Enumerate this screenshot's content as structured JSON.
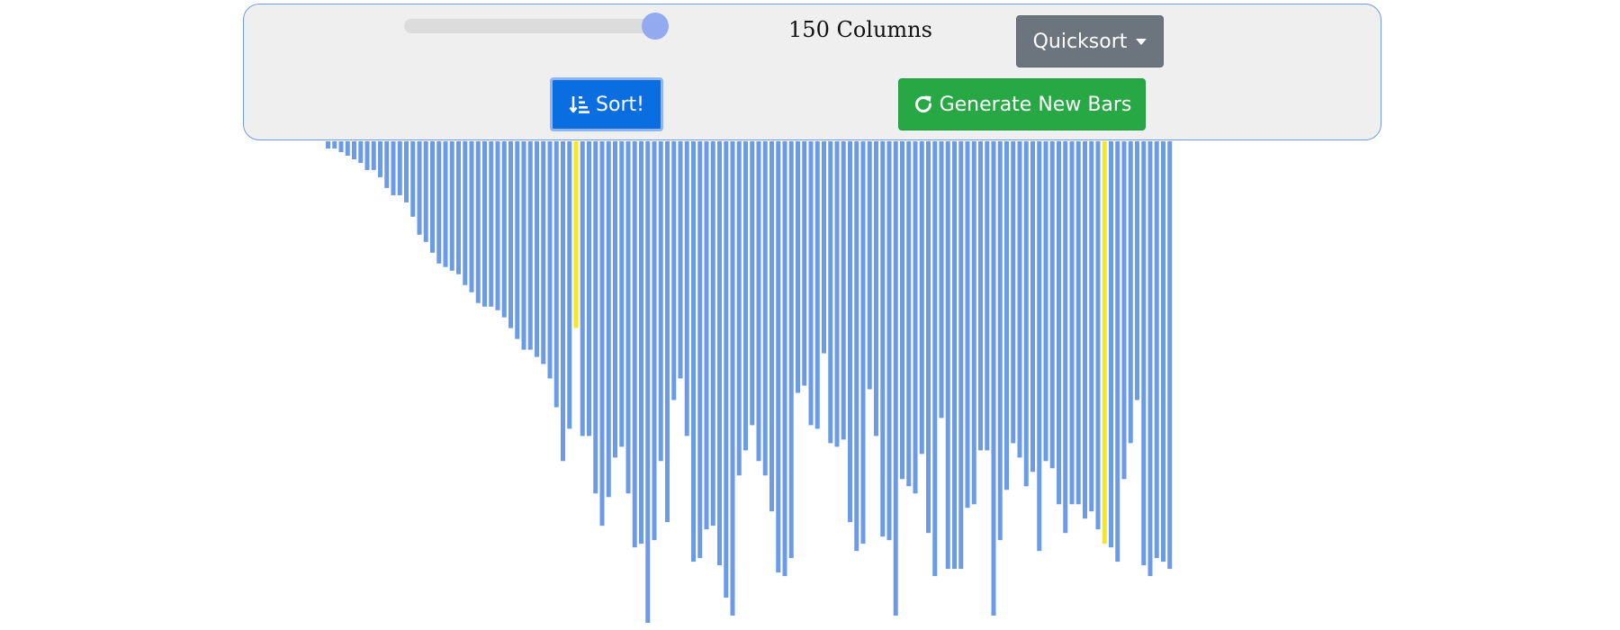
{
  "controls": {
    "column_count_label": "150 Columns",
    "slider_value": 150,
    "algorithm_label": "Quicksort",
    "sort_label": "Sort!",
    "generate_label": "Generate New Bars"
  },
  "icons": {
    "sort": "sort-descending-icon",
    "generate": "refresh-icon",
    "dropdown": "caret-down-icon"
  },
  "colors": {
    "bar": "#6b9be6",
    "highlight": "#f5e81c",
    "sort_button": "#0a6de0",
    "generate_button": "#28a745",
    "algorithm_button": "#6c757d"
  },
  "chart_data": {
    "type": "bar",
    "bar_count": 130,
    "values": [
      2,
      2,
      3,
      4,
      5,
      6,
      8,
      8,
      10,
      13,
      15,
      15,
      17,
      21,
      26,
      28,
      31,
      34,
      35,
      36,
      37,
      40,
      42,
      45,
      46,
      46,
      47,
      49,
      52,
      55,
      58,
      58,
      60,
      62,
      66,
      74,
      89,
      80,
      52,
      82,
      82,
      98,
      107,
      99,
      88,
      85,
      98,
      113,
      112,
      134,
      111,
      89,
      106,
      72,
      66,
      82,
      117,
      116,
      108,
      107,
      118,
      127,
      132,
      93,
      86,
      79,
      89,
      93,
      103,
      120,
      121,
      116,
      70,
      68,
      79,
      80,
      59,
      84,
      85,
      83,
      106,
      114,
      112,
      69,
      82,
      110,
      111,
      132,
      94,
      96,
      98,
      87,
      109,
      121,
      77,
      119,
      119,
      119,
      102,
      101,
      86,
      86,
      132,
      111,
      97,
      84,
      88,
      96,
      92,
      114,
      89,
      91,
      101,
      109,
      101,
      101,
      105,
      103,
      108,
      112,
      113,
      117,
      94,
      84,
      72,
      118,
      121,
      116,
      117,
      119
    ],
    "highlighted_indices": [
      38,
      119
    ],
    "ylim": [
      0,
      136
    ]
  }
}
